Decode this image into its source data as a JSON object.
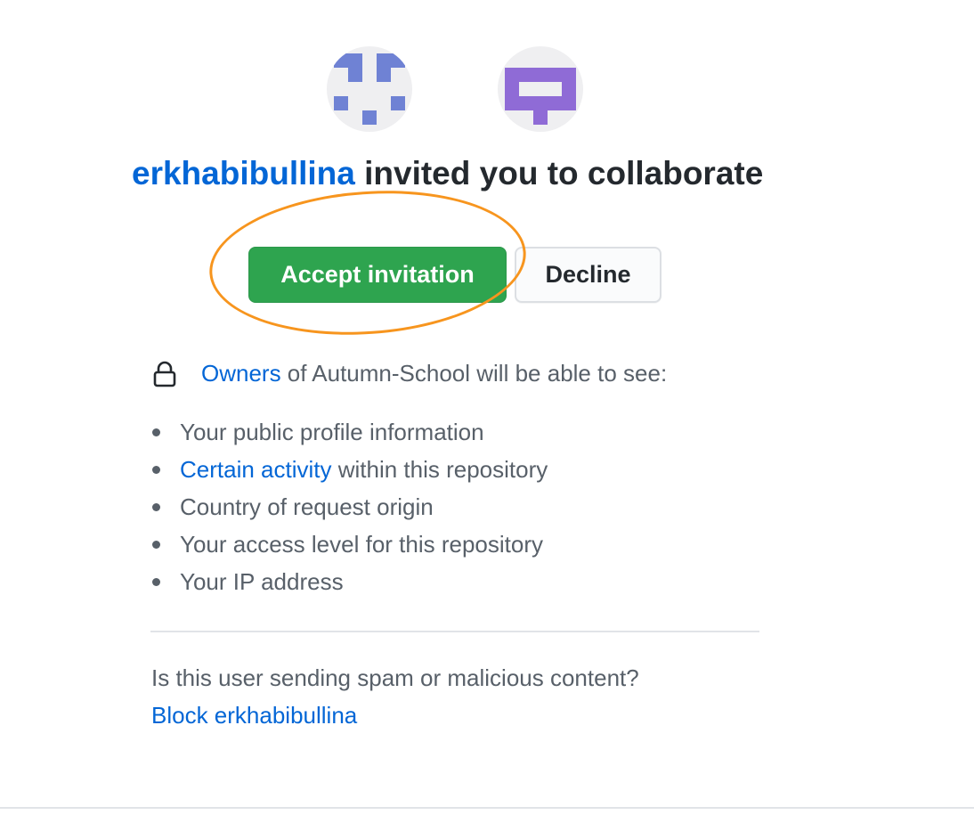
{
  "avatars": {
    "inviter": {
      "icon": "identicon-inviter",
      "color": "#6f82d4"
    },
    "repo": {
      "icon": "identicon-repo",
      "color": "#8f6bd6"
    }
  },
  "headline": {
    "inviter": "erkhabibullina",
    "text": " invited you to collaborate"
  },
  "actions": {
    "accept_label": "Accept invitation",
    "decline_label": "Decline",
    "highlight_color": "#f7951e"
  },
  "visibility": {
    "owners_link": "Owners",
    "text": " of Autumn-School will be able to see:",
    "icon": "lock-icon",
    "items": [
      {
        "link": "",
        "text": "Your public profile information"
      },
      {
        "link": "Certain activity",
        "text": " within this repository"
      },
      {
        "link": "",
        "text": "Country of request origin"
      },
      {
        "link": "",
        "text": "Your access level for this repository"
      },
      {
        "link": "",
        "text": "Your IP address"
      }
    ]
  },
  "report": {
    "question": "Is this user sending spam or malicious content?",
    "block_label": "Block erkhabibullina"
  },
  "colors": {
    "accent_link": "#0366d6",
    "primary_button": "#2ea44f"
  }
}
